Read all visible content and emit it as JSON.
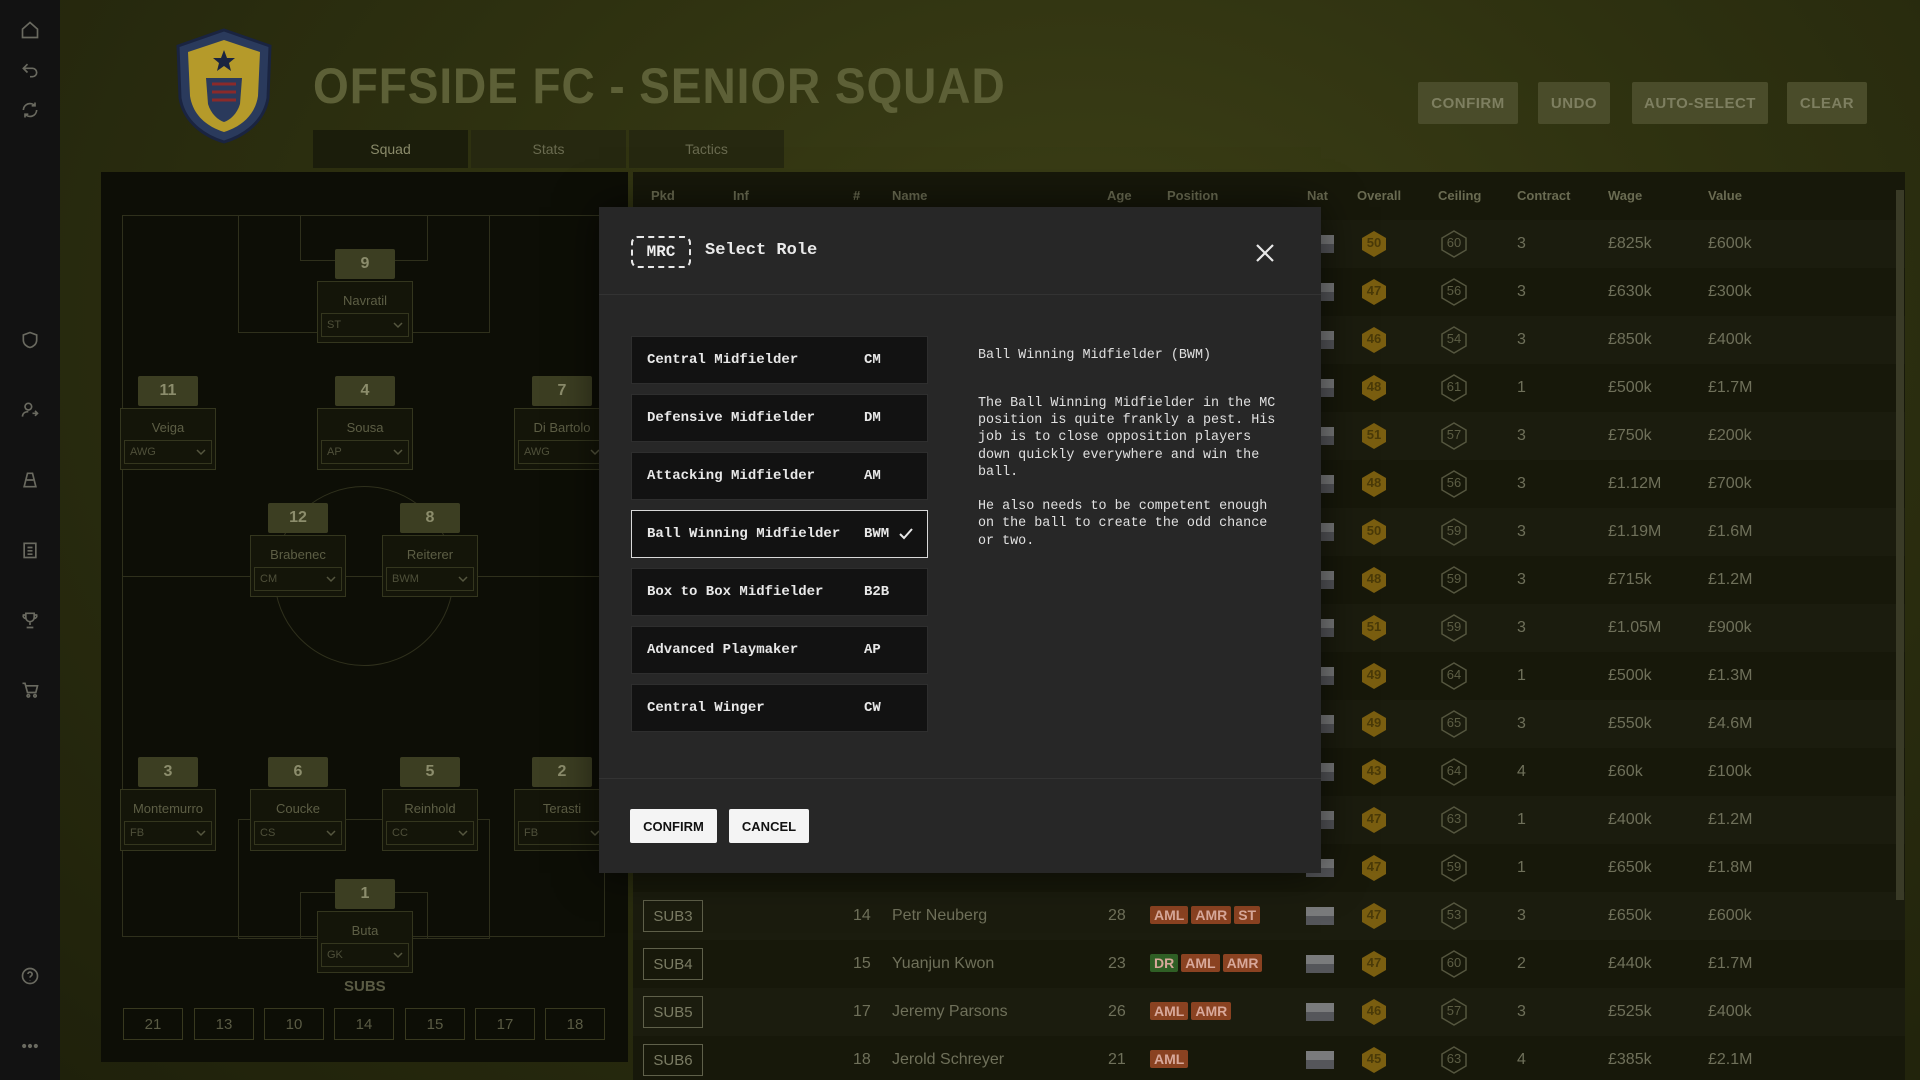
{
  "title": "OFFSIDE FC - SENIOR SQUAD",
  "tabs": [
    "Squad",
    "Stats",
    "Tactics"
  ],
  "top_buttons": {
    "confirm": "CONFIRM",
    "undo": "UNDO",
    "auto_select": "AUTO-SELECT",
    "clear": "CLEAR"
  },
  "pitch": {
    "players": [
      {
        "num": "9",
        "name": "Navratil",
        "role": "ST"
      },
      {
        "num": "11",
        "name": "Veiga",
        "role": "AWG"
      },
      {
        "num": "4",
        "name": "Sousa",
        "role": "AP"
      },
      {
        "num": "7",
        "name": "Di Bartolo",
        "role": "AWG"
      },
      {
        "num": "12",
        "name": "Brabenec",
        "role": "CM"
      },
      {
        "num": "8",
        "name": "Reiterer",
        "role": "BWM"
      },
      {
        "num": "3",
        "name": "Montemurro",
        "role": "FB"
      },
      {
        "num": "6",
        "name": "Coucke",
        "role": "CS"
      },
      {
        "num": "5",
        "name": "Reinhold",
        "role": "CC"
      },
      {
        "num": "2",
        "name": "Terasti",
        "role": "FB"
      },
      {
        "num": "1",
        "name": "Buta",
        "role": "GK"
      }
    ],
    "subs_title": "SUBS",
    "subs": [
      "21",
      "13",
      "10",
      "14",
      "15",
      "17",
      "18"
    ]
  },
  "table": {
    "headers": [
      "Pkd",
      "Inf",
      "#",
      "Name",
      "Age",
      "Position",
      "Nat",
      "Overall",
      "Ceiling",
      "Contract",
      "Wage",
      "Value"
    ],
    "rows": [
      {
        "overall": "50",
        "ceiling": "60",
        "contract": "3",
        "wage": "£825k",
        "value": "£600k"
      },
      {
        "overall": "47",
        "ceiling": "56",
        "contract": "3",
        "wage": "£630k",
        "value": "£300k"
      },
      {
        "overall": "46",
        "ceiling": "54",
        "contract": "3",
        "wage": "£850k",
        "value": "£400k"
      },
      {
        "overall": "48",
        "ceiling": "61",
        "contract": "1",
        "wage": "£500k",
        "value": "£1.7M"
      },
      {
        "overall": "51",
        "ceiling": "57",
        "contract": "3",
        "wage": "£750k",
        "value": "£200k"
      },
      {
        "overall": "48",
        "ceiling": "56",
        "contract": "3",
        "wage": "£1.12M",
        "value": "£700k"
      },
      {
        "overall": "50",
        "ceiling": "59",
        "contract": "3",
        "wage": "£1.19M",
        "value": "£1.6M"
      },
      {
        "overall": "48",
        "ceiling": "59",
        "contract": "3",
        "wage": "£715k",
        "value": "£1.2M"
      },
      {
        "overall": "51",
        "ceiling": "59",
        "contract": "3",
        "wage": "£1.05M",
        "value": "£900k"
      },
      {
        "overall": "49",
        "ceiling": "64",
        "contract": "1",
        "wage": "£500k",
        "value": "£1.3M"
      },
      {
        "overall": "49",
        "ceiling": "65",
        "contract": "3",
        "wage": "£550k",
        "value": "£4.6M"
      },
      {
        "overall": "43",
        "ceiling": "64",
        "contract": "4",
        "wage": "£60k",
        "value": "£100k"
      },
      {
        "overall": "47",
        "ceiling": "63",
        "contract": "1",
        "wage": "£400k",
        "value": "£1.2M"
      },
      {
        "overall": "47",
        "ceiling": "59",
        "contract": "1",
        "wage": "£650k",
        "value": "£1.8M"
      },
      {
        "pkd": "SUB3",
        "num": "14",
        "name": "Petr Neuberg",
        "age": "28",
        "positions": [
          "AML",
          "AMR",
          "ST"
        ],
        "overall": "47",
        "ceiling": "53",
        "contract": "3",
        "wage": "£650k",
        "value": "£600k"
      },
      {
        "pkd": "SUB4",
        "num": "15",
        "name": "Yuanjun Kwon",
        "age": "23",
        "positions": [
          "DR",
          "AML",
          "AMR"
        ],
        "overall": "47",
        "ceiling": "60",
        "contract": "2",
        "wage": "£440k",
        "value": "£1.7M"
      },
      {
        "pkd": "SUB5",
        "num": "17",
        "name": "Jeremy Parsons",
        "age": "26",
        "positions": [
          "AML",
          "AMR"
        ],
        "overall": "46",
        "ceiling": "57",
        "contract": "3",
        "wage": "£525k",
        "value": "£400k"
      },
      {
        "pkd": "SUB6",
        "num": "18",
        "name": "Jerold Schreyer",
        "age": "21",
        "positions": [
          "AML"
        ],
        "overall": "45",
        "ceiling": "63",
        "contract": "4",
        "wage": "£385k",
        "value": "£2.1M"
      }
    ]
  },
  "modal": {
    "badge": "MRC",
    "title": "Select Role",
    "roles": [
      {
        "name": "Central Midfielder",
        "code": "CM"
      },
      {
        "name": "Defensive Midfielder",
        "code": "DM"
      },
      {
        "name": "Attacking Midfielder",
        "code": "AM"
      },
      {
        "name": "Ball Winning Midfielder",
        "code": "BWM",
        "selected": true
      },
      {
        "name": "Box to Box Midfielder",
        "code": "B2B"
      },
      {
        "name": "Advanced Playmaker",
        "code": "AP"
      },
      {
        "name": "Central Winger",
        "code": "CW"
      }
    ],
    "desc_title": "Ball Winning Midfielder (BWM)",
    "desc_body": "The Ball Winning Midfielder in the MC position is quite frankly a pest. His job is to close opposition players down quickly everywhere and win the ball.\n\nHe also needs to be competent enough on the ball to create the odd chance or two.",
    "confirm": "CONFIRM",
    "cancel": "CANCEL"
  },
  "colors": {
    "pos_amber": "#7c3b1e",
    "pos_green": "#2e5a24",
    "overall_hex": "#a17a13"
  }
}
